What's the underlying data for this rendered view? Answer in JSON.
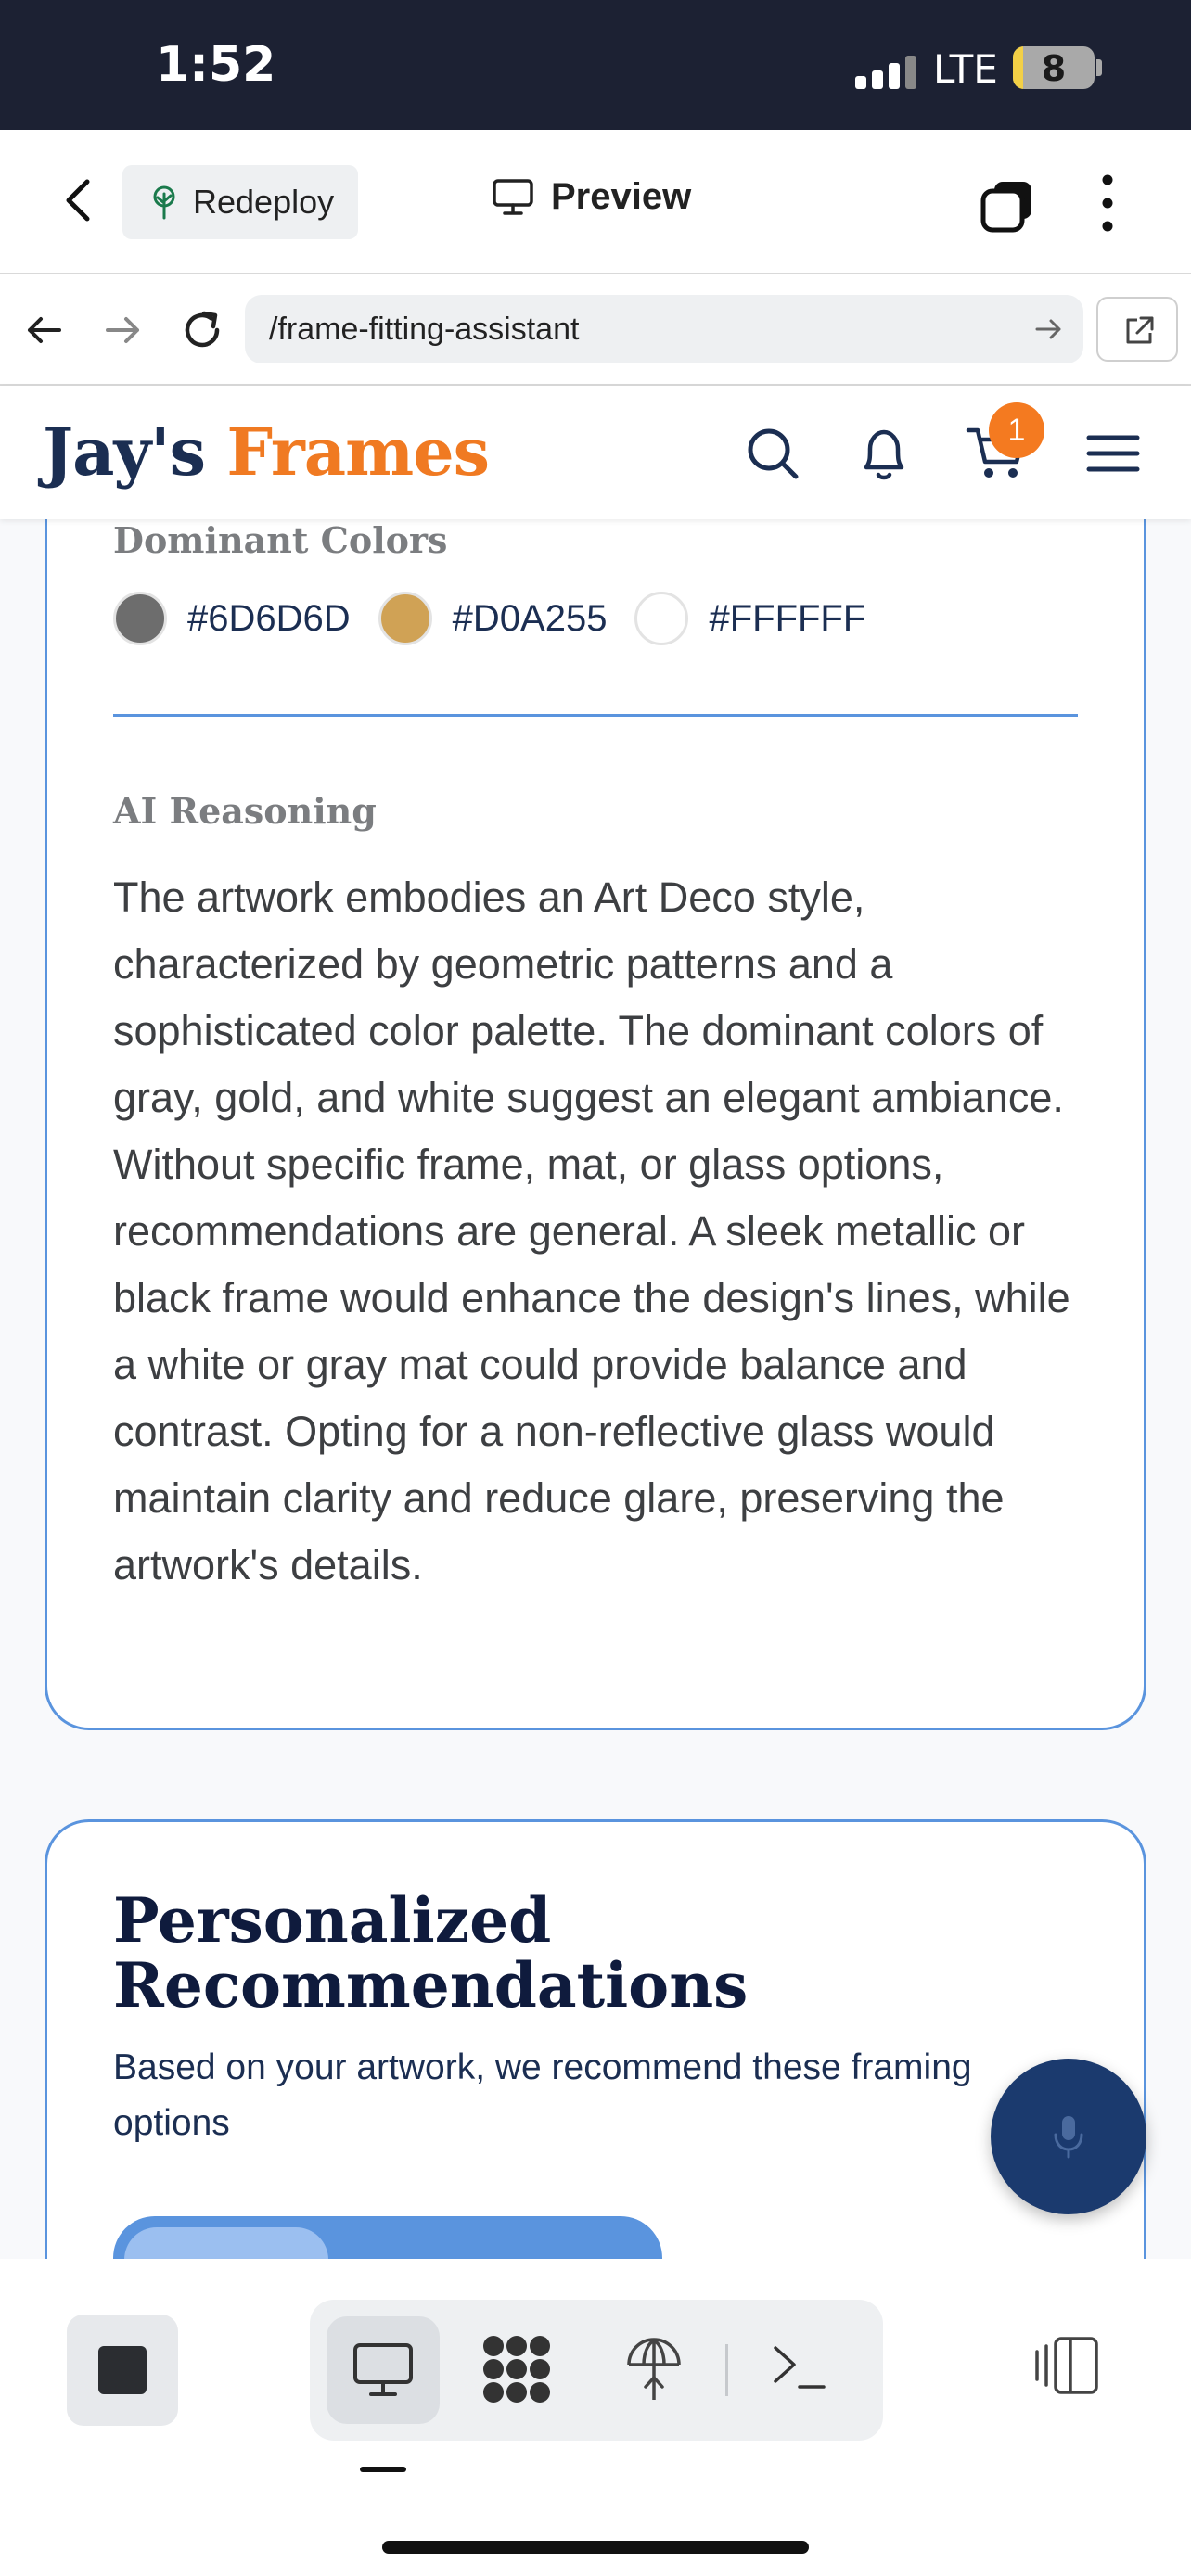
{
  "status_bar": {
    "time": "1:52",
    "network": "LTE",
    "battery": "8",
    "battery_level": 0.08
  },
  "app_bar": {
    "redeploy_label": "Redeploy",
    "preview_label": "Preview"
  },
  "browser": {
    "url": "/frame-fitting-assistant"
  },
  "site": {
    "logo_part1": "Jay's",
    "logo_part2": "Frames",
    "cart_count": "1",
    "brand_colors": {
      "navy": "#1b2e52",
      "orange": "#f07a22",
      "accent_blue": "#5a94de"
    }
  },
  "analysis": {
    "dominant_colors_title": "Dominant Colors",
    "colors": [
      {
        "hex": "#6D6D6D",
        "swatch": "#6D6D6D"
      },
      {
        "hex": "#D0A255",
        "swatch": "#D0A255"
      },
      {
        "hex": "#FFFFFF",
        "swatch": "#FFFFFF"
      }
    ],
    "ai_title": "AI Reasoning",
    "ai_text": "The artwork embodies an Art Deco style, characterized by geometric patterns and a sophisticated color palette. The dominant colors of gray, gold, and white suggest an elegant ambiance. Without specific frame, mat, or glass options, recommendations are general. A sleek metallic or black frame would enhance the design's lines, while a white or gray mat could provide balance and contrast. Opting for a non-reflective glass would maintain clarity and reduce glare, preserving the artwork's details."
  },
  "recommendations": {
    "title": "Personalized Recommendations",
    "subtitle": "Based on your artwork, we recommend these framing options"
  },
  "icons": {
    "back": "chevron-left-icon",
    "redeploy": "tree-icon",
    "preview": "monitor-icon",
    "tabs": "tabs-icon",
    "more": "kebab-icon",
    "search": "search-icon",
    "notifications": "bell-icon",
    "cart": "cart-icon",
    "menu": "hamburger-icon",
    "mic": "microphone-icon"
  }
}
